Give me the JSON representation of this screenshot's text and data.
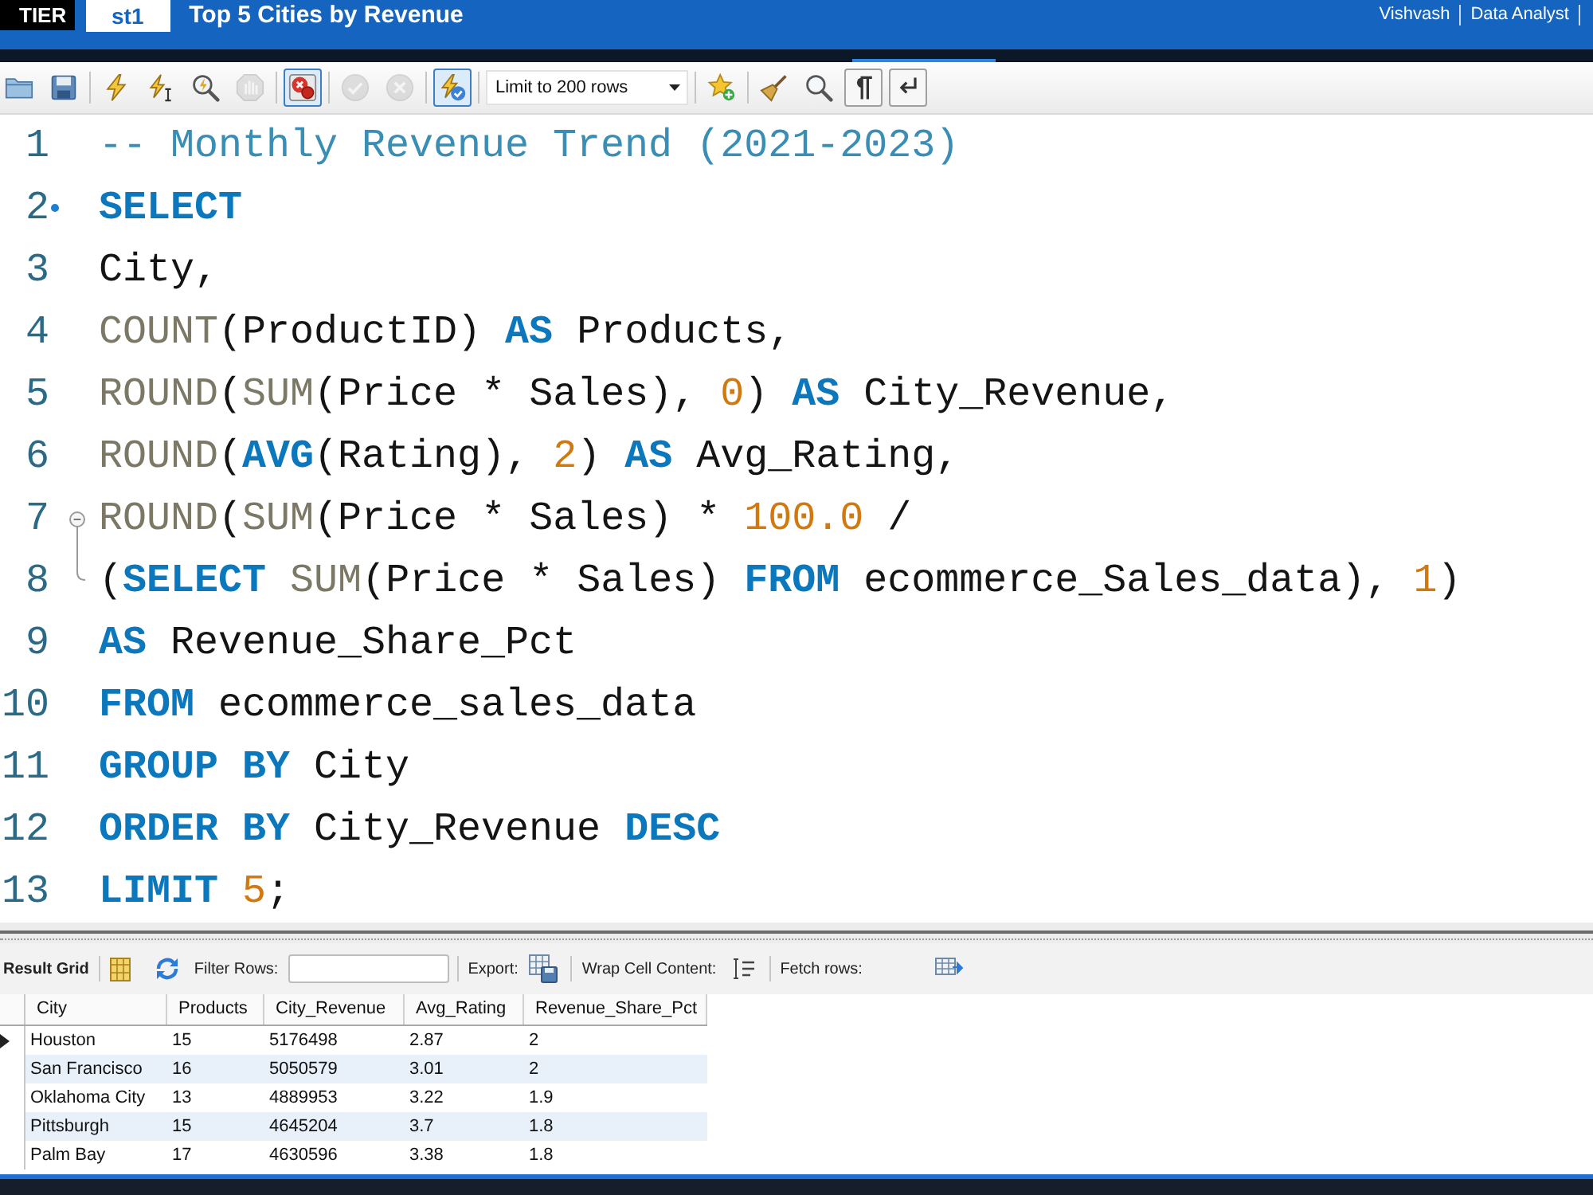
{
  "app_bar": {
    "tier_badge": "TIER",
    "tab": "st1",
    "title": "Top 5 Cities by Revenue",
    "user_menu": [
      "Vishvash",
      "Data Analyst"
    ]
  },
  "toolbar": {
    "left": [
      {
        "kind": "button",
        "on": false,
        "disabled": false
      },
      {
        "kind": "button",
        "on": false,
        "disabled": false
      },
      {
        "kind": "button",
        "on": false,
        "disabled": false
      },
      {
        "kind": "button",
        "on": false,
        "disabled": false
      },
      {
        "kind": "button",
        "on": false,
        "disabled": false
      },
      {
        "kind": "button",
        "on": false,
        "disabled": true
      },
      {
        "kind": "toggle",
        "on": true,
        "disabled": false
      },
      {
        "kind": "button",
        "on": false,
        "disabled": true
      },
      {
        "kind": "button",
        "on": false,
        "disabled": true
      },
      {
        "kind": "toggle",
        "on": true,
        "disabled": false
      }
    ],
    "limit": "Limit to 200 rows",
    "right": [
      {
        "kind": "button",
        "on": false,
        "disabled": false
      },
      {
        "kind": "button",
        "on": false,
        "disabled": false
      },
      {
        "kind": "button",
        "on": false,
        "disabled": false
      },
      {
        "kind": "toggle",
        "on": false,
        "disabled": false
      },
      {
        "kind": "toggle",
        "on": false,
        "disabled": false
      }
    ]
  },
  "editor": {
    "lines": [
      {
        "number": "1",
        "tokens": [
          {
            "kind": "comment",
            "text": "-- Monthly Revenue Trend (2021-2023)"
          }
        ]
      },
      {
        "number": "2",
        "gutter": {
          "kind": "statement"
        },
        "tokens": [
          {
            "kind": "keyword",
            "text": "SELECT"
          }
        ]
      },
      {
        "number": "3",
        "tokens": [
          {
            "kind": "text",
            "text": "City,"
          }
        ]
      },
      {
        "number": "4",
        "tokens": [
          {
            "kind": "function",
            "text": "COUNT"
          },
          {
            "kind": "text",
            "text": "(ProductID) "
          },
          {
            "kind": "keyword",
            "text": "AS"
          },
          {
            "kind": "text",
            "text": " Products,"
          }
        ]
      },
      {
        "number": "5",
        "tokens": [
          {
            "kind": "function",
            "text": "ROUND"
          },
          {
            "kind": "text",
            "text": "("
          },
          {
            "kind": "function",
            "text": "SUM"
          },
          {
            "kind": "text",
            "text": "(Price * Sales), "
          },
          {
            "kind": "number",
            "text": "0"
          },
          {
            "kind": "text",
            "text": ") "
          },
          {
            "kind": "keyword",
            "text": "AS"
          },
          {
            "kind": "text",
            "text": " City_Revenue,"
          }
        ]
      },
      {
        "number": "6",
        "tokens": [
          {
            "kind": "function",
            "text": "ROUND"
          },
          {
            "kind": "text",
            "text": "("
          },
          {
            "kind": "keyword",
            "text": "AVG"
          },
          {
            "kind": "text",
            "text": "(Rating), "
          },
          {
            "kind": "number",
            "text": "2"
          },
          {
            "kind": "text",
            "text": ") "
          },
          {
            "kind": "keyword",
            "text": "AS"
          },
          {
            "kind": "text",
            "text": " Avg_Rating,"
          }
        ]
      },
      {
        "number": "7",
        "gutter": {
          "kind": "fold-open"
        },
        "tokens": [
          {
            "kind": "function",
            "text": "ROUND"
          },
          {
            "kind": "text",
            "text": "("
          },
          {
            "kind": "function",
            "text": "SUM"
          },
          {
            "kind": "text",
            "text": "(Price * Sales) * "
          },
          {
            "kind": "number",
            "text": "100.0"
          },
          {
            "kind": "text",
            "text": " /"
          }
        ]
      },
      {
        "number": "8",
        "gutter": {
          "kind": "fold-end"
        },
        "tokens": [
          {
            "kind": "text",
            "text": "("
          },
          {
            "kind": "keyword",
            "text": "SELECT "
          },
          {
            "kind": "function",
            "text": "SUM"
          },
          {
            "kind": "text",
            "text": "(Price * Sales) "
          },
          {
            "kind": "keyword",
            "text": "FROM"
          },
          {
            "kind": "text",
            "text": " ecommerce_Sales_data), "
          },
          {
            "kind": "number",
            "text": "1"
          },
          {
            "kind": "text",
            "text": ")"
          }
        ]
      },
      {
        "number": "9",
        "tokens": [
          {
            "kind": "keyword",
            "text": "AS"
          },
          {
            "kind": "text",
            "text": " Revenue_Share_Pct"
          }
        ]
      },
      {
        "number": "10",
        "tokens": [
          {
            "kind": "keyword",
            "text": "FROM"
          },
          {
            "kind": "text",
            "text": " ecommerce_sales_data"
          }
        ]
      },
      {
        "number": "11",
        "tokens": [
          {
            "kind": "keyword",
            "text": "GROUP BY"
          },
          {
            "kind": "text",
            "text": " City"
          }
        ]
      },
      {
        "number": "12",
        "tokens": [
          {
            "kind": "keyword",
            "text": "ORDER BY"
          },
          {
            "kind": "text",
            "text": " City_Revenue "
          },
          {
            "kind": "keyword",
            "text": "DESC"
          }
        ]
      },
      {
        "number": "13",
        "tokens": [
          {
            "kind": "keyword",
            "text": "LIMIT "
          },
          {
            "kind": "number",
            "text": "5"
          },
          {
            "kind": "text",
            "text": ";"
          }
        ]
      }
    ]
  },
  "result_toolbar": {
    "title": "Result Grid",
    "filter_label": "Filter Rows:",
    "export_label": "Export:",
    "wrap_label": "Wrap Cell Content:",
    "fetch_label": "Fetch rows:"
  },
  "result_grid": {
    "columns": [
      "City",
      "Products",
      "City_Revenue",
      "Avg_Rating",
      "Revenue_Share_Pct"
    ],
    "rows": [
      {
        "selected": true,
        "cells": [
          "Houston",
          "15",
          "5176498",
          "2.87",
          "2"
        ]
      },
      {
        "selected": false,
        "cells": [
          "San Francisco",
          "16",
          "5050579",
          "3.01",
          "2"
        ]
      },
      {
        "selected": false,
        "cells": [
          "Oklahoma City",
          "13",
          "4889953",
          "3.22",
          "1.9"
        ]
      },
      {
        "selected": false,
        "cells": [
          "Pittsburgh",
          "15",
          "4645204",
          "3.7",
          "1.8"
        ]
      },
      {
        "selected": false,
        "cells": [
          "Palm Bay",
          "17",
          "4630596",
          "3.38",
          "1.8"
        ]
      }
    ]
  }
}
